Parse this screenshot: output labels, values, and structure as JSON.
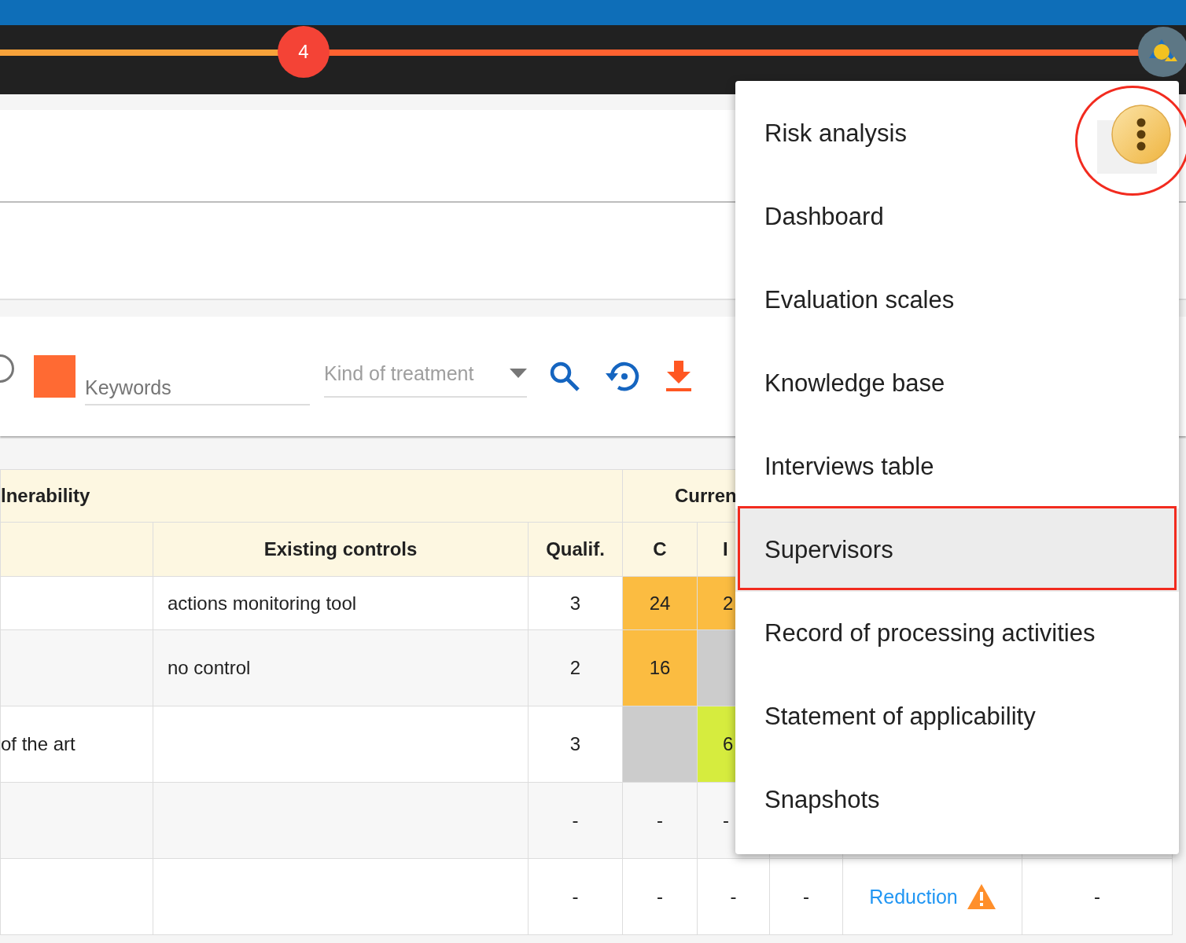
{
  "progress": {
    "level": 0.265,
    "badge": "4"
  },
  "toolbar": {
    "radio": {
      "checked": false
    },
    "keywords": {
      "placeholder": "Keywords"
    },
    "treatment": {
      "placeholder": "Kind of treatment"
    }
  },
  "table": {
    "groups": [
      {
        "label": "lnerability"
      },
      {
        "label": "Curren"
      }
    ],
    "columns": [
      "",
      "Existing controls",
      "Qualif.",
      "C",
      "I"
    ],
    "rows": [
      {
        "cells": [
          {
            "text": ""
          },
          {
            "text": "actions monitoring tool"
          },
          {
            "text": "3"
          },
          {
            "text": "24",
            "color": "#fbbc41"
          },
          {
            "text": "2",
            "color": "#fbbc41"
          }
        ]
      },
      {
        "cells": [
          {
            "text": ""
          },
          {
            "text": "no control"
          },
          {
            "text": "2"
          },
          {
            "text": "16",
            "color": "#fbbc41"
          },
          {
            "text": "",
            "color": "#cccccc"
          }
        ]
      },
      {
        "cells": [
          {
            "text": "of the art"
          },
          {
            "text": ""
          },
          {
            "text": "3"
          },
          {
            "text": "",
            "color": "#cccccc"
          },
          {
            "text": "6",
            "color": "#d6ec3e"
          }
        ]
      },
      {
        "cells": [
          {
            "text": ""
          },
          {
            "text": ""
          },
          {
            "text": "-"
          },
          {
            "text": "-"
          },
          {
            "text": "-"
          }
        ]
      },
      {
        "cells": [
          {
            "text": ""
          },
          {
            "text": ""
          },
          {
            "text": "-"
          },
          {
            "text": "-"
          },
          {
            "text": "-"
          },
          {
            "text": "-"
          },
          {
            "text": "Reduction",
            "kind": "link",
            "warning": true
          },
          {
            "text": "-"
          }
        ]
      }
    ]
  },
  "menu": {
    "items": [
      {
        "label": "Risk analysis",
        "selected": false
      },
      {
        "label": "Dashboard",
        "selected": false
      },
      {
        "label": "Evaluation scales",
        "selected": false
      },
      {
        "label": "Knowledge base",
        "selected": false
      },
      {
        "label": "Interviews table",
        "selected": false
      },
      {
        "label": "Supervisors",
        "selected": true
      },
      {
        "label": "Record of processing activities",
        "selected": false
      },
      {
        "label": "Statement of applicability",
        "selected": false
      },
      {
        "label": "Snapshots",
        "selected": false
      }
    ]
  },
  "annotations": [
    {
      "kind": "circle"
    },
    {
      "kind": "box"
    }
  ]
}
